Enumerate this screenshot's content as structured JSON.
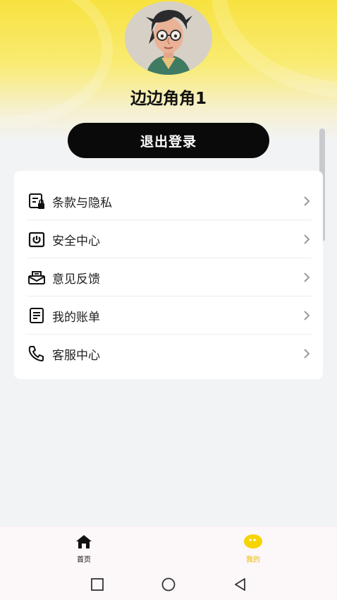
{
  "profile": {
    "username": "边边角角1"
  },
  "actions": {
    "logout_label": "退出登录"
  },
  "menu": [
    {
      "label": "条款与隐私",
      "icon": "terms-lock-icon"
    },
    {
      "label": "安全中心",
      "icon": "security-icon"
    },
    {
      "label": "意见反馈",
      "icon": "feedback-mail-icon"
    },
    {
      "label": "我的账单",
      "icon": "bill-icon"
    },
    {
      "label": "客服中心",
      "icon": "phone-icon"
    }
  ],
  "tabbar": {
    "home_label": "首页",
    "mine_label": "我的"
  },
  "colors": {
    "brand_yellow": "#f7e23f",
    "active_tab": "#f2c200",
    "button_bg": "#0a0a0a"
  }
}
